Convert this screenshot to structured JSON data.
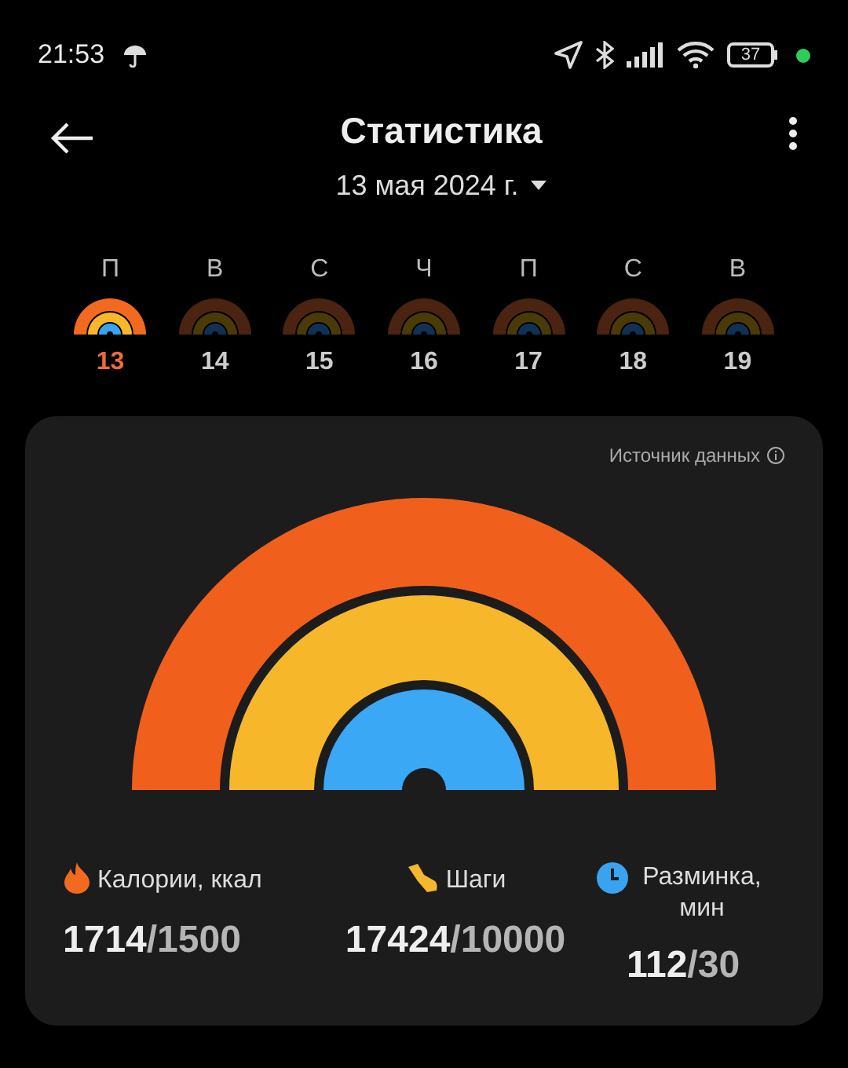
{
  "status_bar": {
    "time": "21:53",
    "battery": "37"
  },
  "header": {
    "title": "Статистика",
    "date": "13 мая 2024 г."
  },
  "days": [
    {
      "weekday": "П",
      "date": "13",
      "selected": true
    },
    {
      "weekday": "В",
      "date": "14",
      "selected": false
    },
    {
      "weekday": "С",
      "date": "15",
      "selected": false
    },
    {
      "weekday": "Ч",
      "date": "16",
      "selected": false
    },
    {
      "weekday": "П",
      "date": "17",
      "selected": false
    },
    {
      "weekday": "С",
      "date": "18",
      "selected": false
    },
    {
      "weekday": "В",
      "date": "19",
      "selected": false
    }
  ],
  "card": {
    "source_link": "Источник данных",
    "stats": [
      {
        "kind": "calories",
        "label": "Калории, ккал",
        "value": "1714",
        "goal": "/1500"
      },
      {
        "kind": "steps",
        "label": "Шаги",
        "value": "17424",
        "goal": "/10000"
      },
      {
        "kind": "workout",
        "label": "Разминка, мин",
        "value": "112",
        "goal": "/30"
      }
    ]
  }
}
